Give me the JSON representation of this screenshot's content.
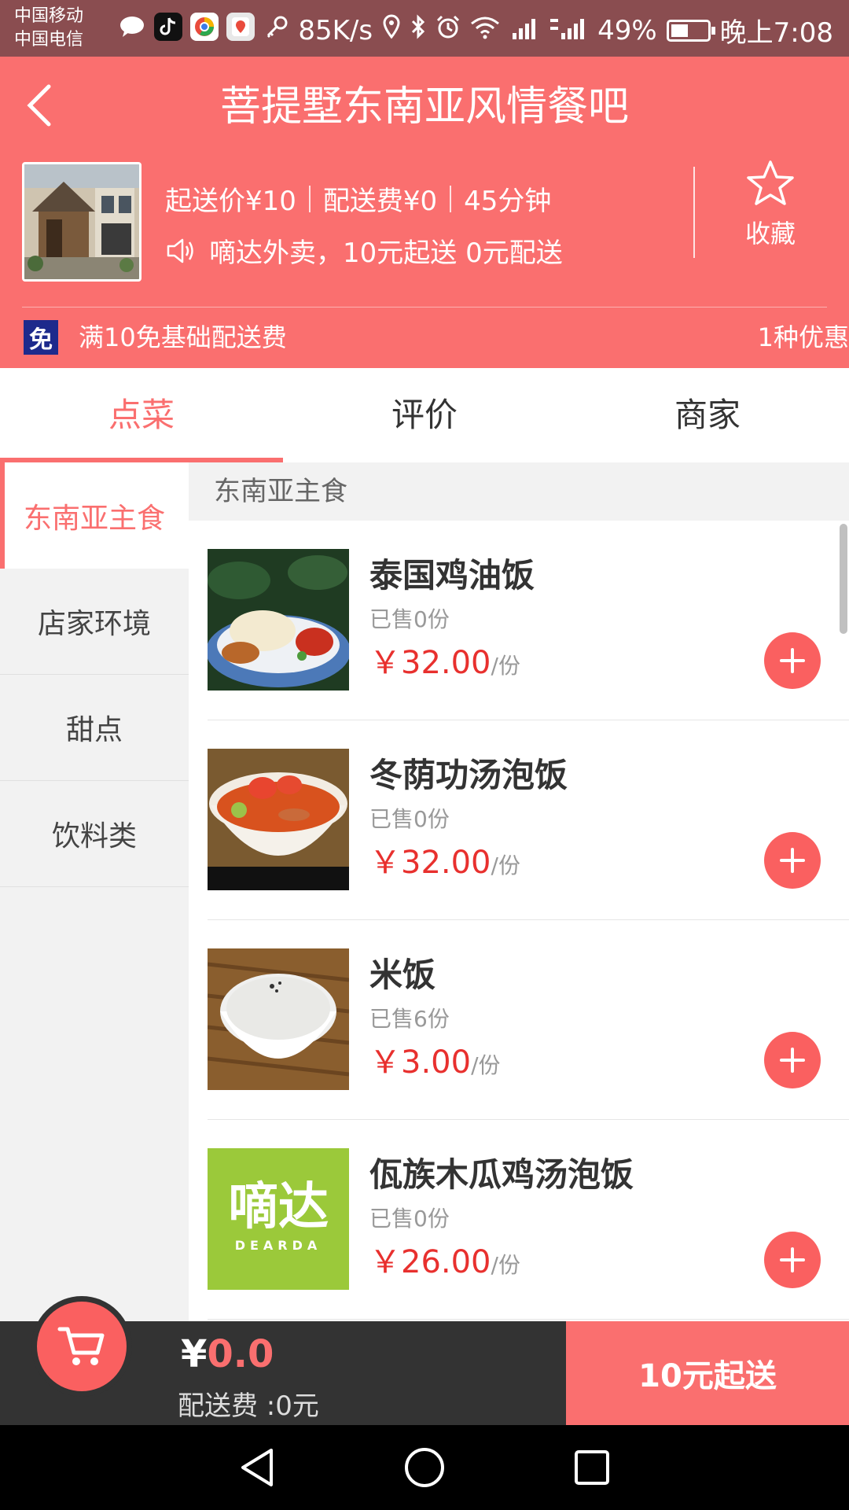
{
  "status_bar": {
    "carrier1": "中国移动",
    "carrier2": "中国电信",
    "speed": "85K/s",
    "battery": "49%",
    "battery_level": 0.49,
    "time": "晚上7:08"
  },
  "header": {
    "title": "菩提墅东南亚风情餐吧",
    "min_order": "起送价¥10",
    "delivery_fee": "配送费¥0",
    "delivery_time": "45分钟",
    "announcement": "嘀达外卖，10元起送 0元配送",
    "favorite_label": "收藏",
    "promo_badge": "免",
    "promo_text": "满10免基础配送费",
    "promo_count": "1种优惠"
  },
  "tabs": [
    {
      "label": "点菜",
      "active": true
    },
    {
      "label": "评价",
      "active": false
    },
    {
      "label": "商家",
      "active": false
    }
  ],
  "categories": [
    {
      "label": "东南亚主食",
      "active": true
    },
    {
      "label": "店家环境",
      "active": false
    },
    {
      "label": "甜点",
      "active": false
    },
    {
      "label": "饮料类",
      "active": false
    }
  ],
  "section_title": "东南亚主食",
  "items": [
    {
      "name": "泰国鸡油饭",
      "sold": "已售0份",
      "price": "￥32.00",
      "unit": "/份"
    },
    {
      "name": "冬荫功汤泡饭",
      "sold": "已售0份",
      "price": "￥32.00",
      "unit": "/份"
    },
    {
      "name": "米饭",
      "sold": "已售6份",
      "price": "￥3.00",
      "unit": "/份"
    },
    {
      "name": "佤族木瓜鸡汤泡饭",
      "sold": "已售0份",
      "price": "￥26.00",
      "unit": "/份",
      "thumb_text": "嘀达",
      "thumb_subtext": "DEARDA"
    }
  ],
  "cart": {
    "currency": "¥",
    "amount": "0.0",
    "fee": "配送费 :0元",
    "checkout_label": "10元起送"
  },
  "colors": {
    "accent": "#fa6f6f",
    "price": "#e8302e",
    "status_bar": "#8a4d50",
    "cart_bar": "#333333"
  },
  "icons": {
    "back": "chevron-left-icon",
    "favorite": "star-icon",
    "announcement": "speaker-icon",
    "add": "plus-icon",
    "cart": "cart-icon"
  }
}
